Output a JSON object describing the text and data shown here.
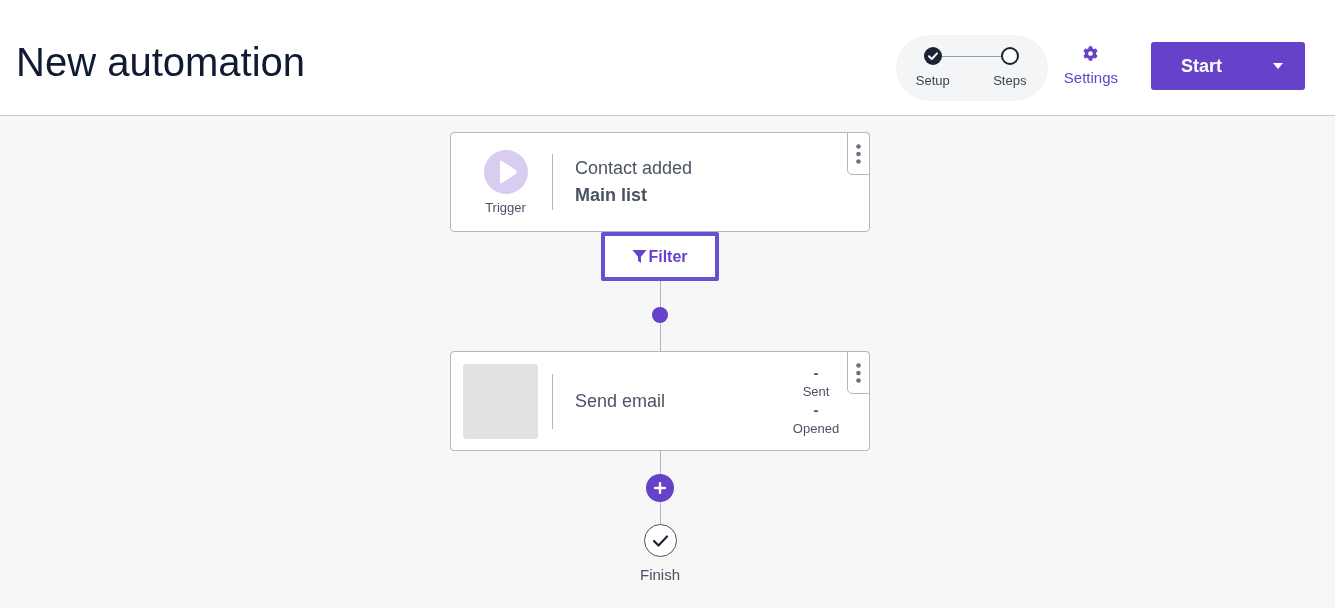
{
  "header": {
    "title": "New automation",
    "stepper": {
      "steps": [
        {
          "label": "Setup",
          "completed": true
        },
        {
          "label": "Steps",
          "completed": false
        }
      ]
    },
    "settings": {
      "label": "Settings"
    },
    "start_button": {
      "label": "Start"
    }
  },
  "flow": {
    "trigger": {
      "label": "Trigger",
      "event": "Contact added",
      "list": "Main list"
    },
    "filter": {
      "label": "Filter"
    },
    "steps": [
      {
        "kind": "email",
        "title": "Send email",
        "stats": [
          {
            "value": "-",
            "label": "Sent"
          },
          {
            "value": "-",
            "label": "Opened"
          }
        ]
      }
    ],
    "finish": {
      "label": "Finish"
    }
  }
}
